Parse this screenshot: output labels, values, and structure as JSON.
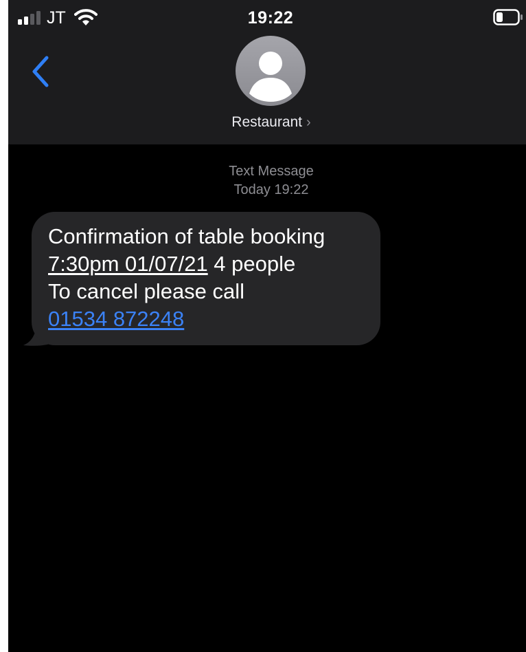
{
  "status_bar": {
    "carrier": "JT",
    "time": "19:22"
  },
  "contact": {
    "name": "Restaurant",
    "chevron": "›"
  },
  "thread": {
    "meta_type": "Text Message",
    "meta_time": "Today 19:22"
  },
  "message": {
    "line1": "Confirmation of table booking",
    "datetime_link": "7:30pm 01/07/21",
    "line2_rest": " 4 people",
    "line3": "To cancel please call",
    "phone_link": "01534 872248"
  },
  "colors": {
    "header_bg": "#1c1c1e",
    "screen_bg": "#000000",
    "bubble_bg": "#262628",
    "accent_blue": "#3b82f6",
    "meta_gray": "#8e8e93"
  },
  "icons": {
    "signal": "signal-bars-icon",
    "wifi": "wifi-icon",
    "battery": "battery-icon",
    "back": "chevron-left-icon",
    "avatar": "person-icon"
  }
}
